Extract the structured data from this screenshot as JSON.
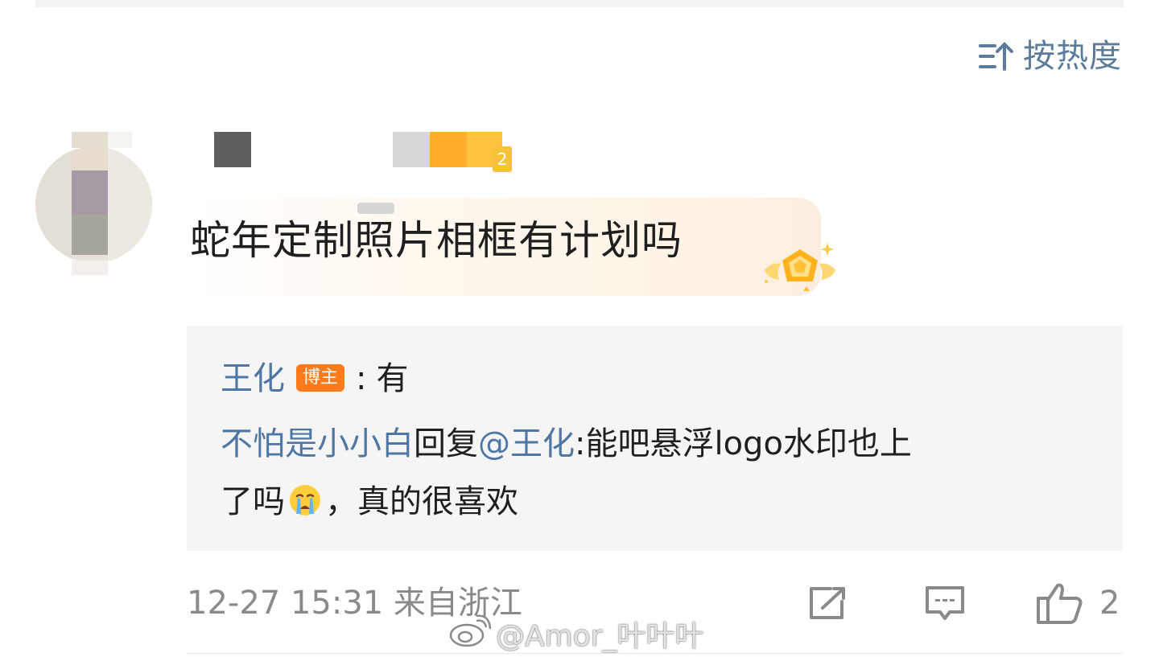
{
  "sort": {
    "label": "按热度",
    "icon": "sort-icon"
  },
  "comment": {
    "text": "蛇年定制照片相框有计划吗",
    "level_badge": "2",
    "medal_icon": "fan-medal-icon"
  },
  "replies": [
    {
      "user": "王化",
      "badge": "博主",
      "separator": ":",
      "text": "有"
    },
    {
      "user": "不怕是小小白",
      "action": "回复",
      "mention": "@王化",
      "text_line1": ":能吧悬浮logo水印也上",
      "text_line2_before": "了吗",
      "emoji": "loudly-crying-face-emoji",
      "text_line2_after": "，真的很喜欢"
    }
  ],
  "footer": {
    "meta": "12-27 15:31 来自浙江",
    "like_count": "2",
    "share_icon": "share-icon",
    "comment_icon": "comment-icon",
    "like_icon": "thumbs-up-icon"
  },
  "watermark": {
    "text": "@Amor_叶叶叶",
    "icon": "weibo-logo-icon"
  },
  "colors": {
    "link": "#4e77a3",
    "sort": "#5b7d9b",
    "meta": "#8a8a8a",
    "badge": "#ff7a1a",
    "reply_bg": "#f5f5f5"
  }
}
